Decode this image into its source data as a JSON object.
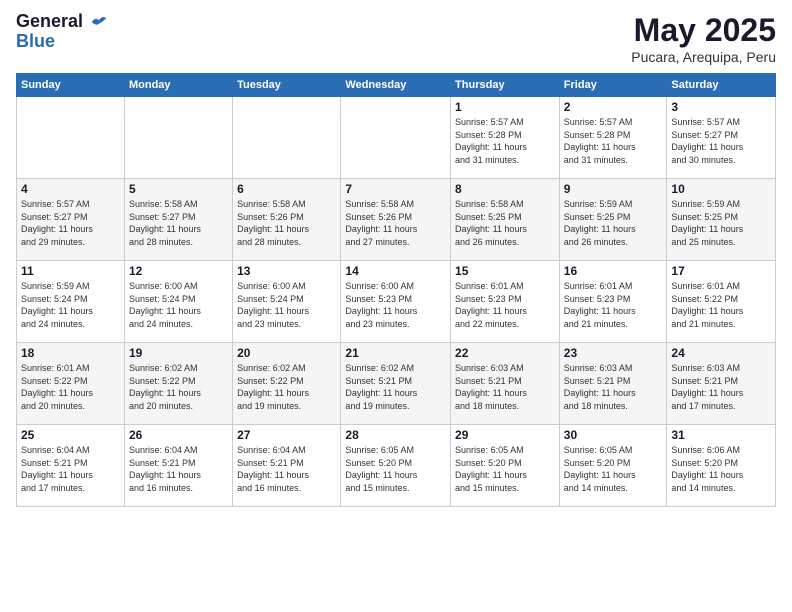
{
  "logo": {
    "line1": "General",
    "line2": "Blue"
  },
  "title": "May 2025",
  "subtitle": "Pucara, Arequipa, Peru",
  "days_of_week": [
    "Sunday",
    "Monday",
    "Tuesday",
    "Wednesday",
    "Thursday",
    "Friday",
    "Saturday"
  ],
  "weeks": [
    [
      {
        "day": "",
        "info": ""
      },
      {
        "day": "",
        "info": ""
      },
      {
        "day": "",
        "info": ""
      },
      {
        "day": "",
        "info": ""
      },
      {
        "day": "1",
        "info": "Sunrise: 5:57 AM\nSunset: 5:28 PM\nDaylight: 11 hours\nand 31 minutes."
      },
      {
        "day": "2",
        "info": "Sunrise: 5:57 AM\nSunset: 5:28 PM\nDaylight: 11 hours\nand 31 minutes."
      },
      {
        "day": "3",
        "info": "Sunrise: 5:57 AM\nSunset: 5:27 PM\nDaylight: 11 hours\nand 30 minutes."
      }
    ],
    [
      {
        "day": "4",
        "info": "Sunrise: 5:57 AM\nSunset: 5:27 PM\nDaylight: 11 hours\nand 29 minutes."
      },
      {
        "day": "5",
        "info": "Sunrise: 5:58 AM\nSunset: 5:27 PM\nDaylight: 11 hours\nand 28 minutes."
      },
      {
        "day": "6",
        "info": "Sunrise: 5:58 AM\nSunset: 5:26 PM\nDaylight: 11 hours\nand 28 minutes."
      },
      {
        "day": "7",
        "info": "Sunrise: 5:58 AM\nSunset: 5:26 PM\nDaylight: 11 hours\nand 27 minutes."
      },
      {
        "day": "8",
        "info": "Sunrise: 5:58 AM\nSunset: 5:25 PM\nDaylight: 11 hours\nand 26 minutes."
      },
      {
        "day": "9",
        "info": "Sunrise: 5:59 AM\nSunset: 5:25 PM\nDaylight: 11 hours\nand 26 minutes."
      },
      {
        "day": "10",
        "info": "Sunrise: 5:59 AM\nSunset: 5:25 PM\nDaylight: 11 hours\nand 25 minutes."
      }
    ],
    [
      {
        "day": "11",
        "info": "Sunrise: 5:59 AM\nSunset: 5:24 PM\nDaylight: 11 hours\nand 24 minutes."
      },
      {
        "day": "12",
        "info": "Sunrise: 6:00 AM\nSunset: 5:24 PM\nDaylight: 11 hours\nand 24 minutes."
      },
      {
        "day": "13",
        "info": "Sunrise: 6:00 AM\nSunset: 5:24 PM\nDaylight: 11 hours\nand 23 minutes."
      },
      {
        "day": "14",
        "info": "Sunrise: 6:00 AM\nSunset: 5:23 PM\nDaylight: 11 hours\nand 23 minutes."
      },
      {
        "day": "15",
        "info": "Sunrise: 6:01 AM\nSunset: 5:23 PM\nDaylight: 11 hours\nand 22 minutes."
      },
      {
        "day": "16",
        "info": "Sunrise: 6:01 AM\nSunset: 5:23 PM\nDaylight: 11 hours\nand 21 minutes."
      },
      {
        "day": "17",
        "info": "Sunrise: 6:01 AM\nSunset: 5:22 PM\nDaylight: 11 hours\nand 21 minutes."
      }
    ],
    [
      {
        "day": "18",
        "info": "Sunrise: 6:01 AM\nSunset: 5:22 PM\nDaylight: 11 hours\nand 20 minutes."
      },
      {
        "day": "19",
        "info": "Sunrise: 6:02 AM\nSunset: 5:22 PM\nDaylight: 11 hours\nand 20 minutes."
      },
      {
        "day": "20",
        "info": "Sunrise: 6:02 AM\nSunset: 5:22 PM\nDaylight: 11 hours\nand 19 minutes."
      },
      {
        "day": "21",
        "info": "Sunrise: 6:02 AM\nSunset: 5:21 PM\nDaylight: 11 hours\nand 19 minutes."
      },
      {
        "day": "22",
        "info": "Sunrise: 6:03 AM\nSunset: 5:21 PM\nDaylight: 11 hours\nand 18 minutes."
      },
      {
        "day": "23",
        "info": "Sunrise: 6:03 AM\nSunset: 5:21 PM\nDaylight: 11 hours\nand 18 minutes."
      },
      {
        "day": "24",
        "info": "Sunrise: 6:03 AM\nSunset: 5:21 PM\nDaylight: 11 hours\nand 17 minutes."
      }
    ],
    [
      {
        "day": "25",
        "info": "Sunrise: 6:04 AM\nSunset: 5:21 PM\nDaylight: 11 hours\nand 17 minutes."
      },
      {
        "day": "26",
        "info": "Sunrise: 6:04 AM\nSunset: 5:21 PM\nDaylight: 11 hours\nand 16 minutes."
      },
      {
        "day": "27",
        "info": "Sunrise: 6:04 AM\nSunset: 5:21 PM\nDaylight: 11 hours\nand 16 minutes."
      },
      {
        "day": "28",
        "info": "Sunrise: 6:05 AM\nSunset: 5:20 PM\nDaylight: 11 hours\nand 15 minutes."
      },
      {
        "day": "29",
        "info": "Sunrise: 6:05 AM\nSunset: 5:20 PM\nDaylight: 11 hours\nand 15 minutes."
      },
      {
        "day": "30",
        "info": "Sunrise: 6:05 AM\nSunset: 5:20 PM\nDaylight: 11 hours\nand 14 minutes."
      },
      {
        "day": "31",
        "info": "Sunrise: 6:06 AM\nSunset: 5:20 PM\nDaylight: 11 hours\nand 14 minutes."
      }
    ]
  ]
}
